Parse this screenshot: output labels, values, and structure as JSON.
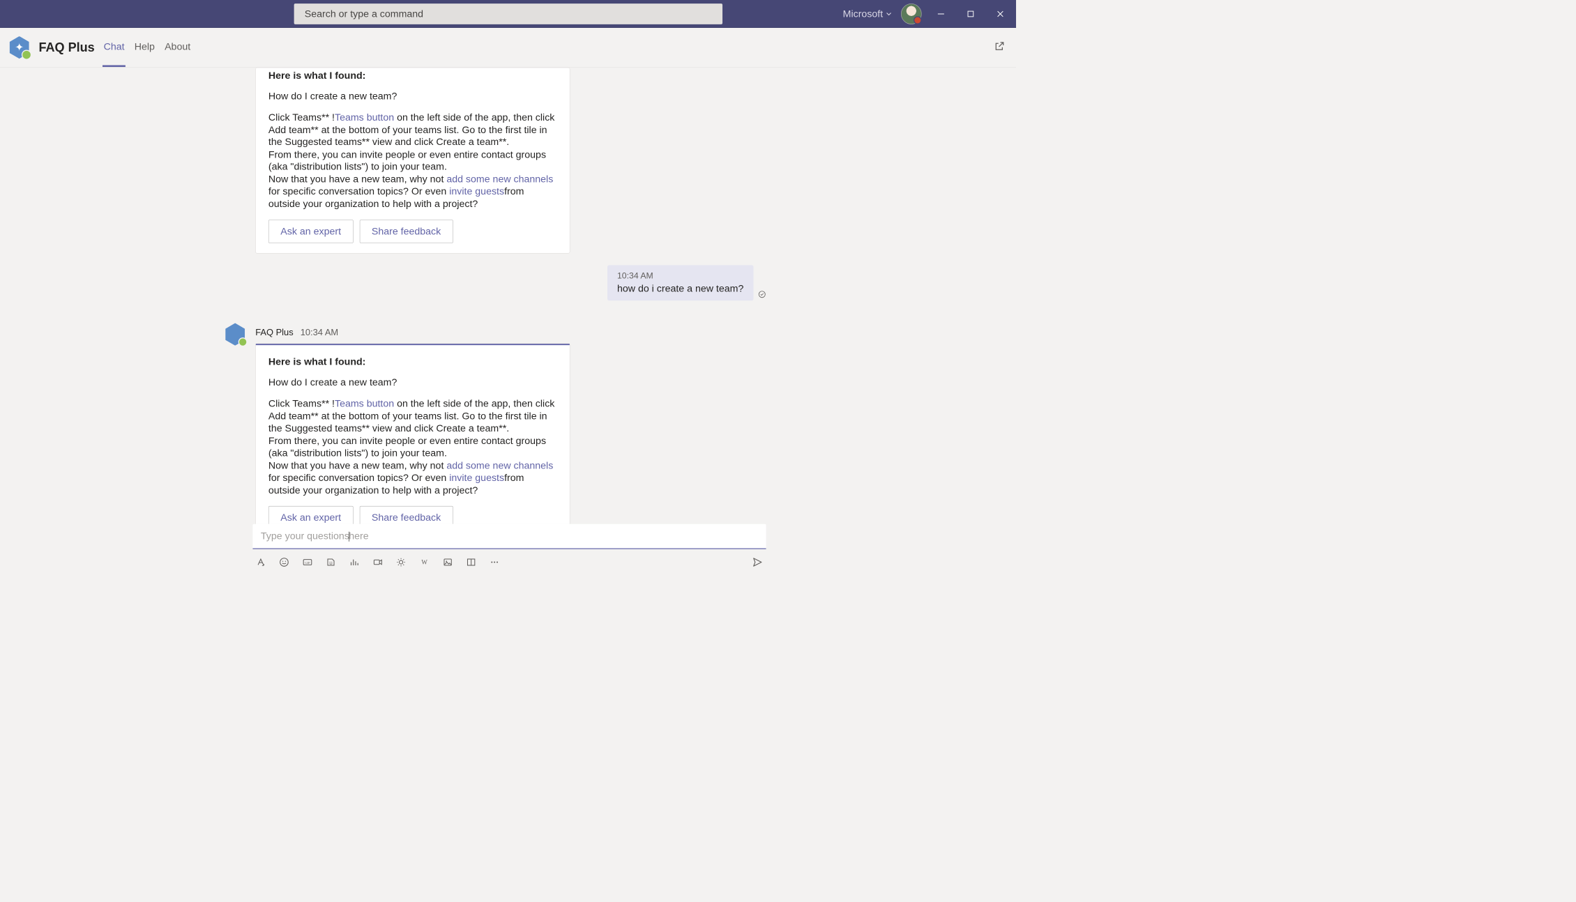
{
  "titlebar": {
    "search_placeholder": "Search or type a command",
    "org_label": "Microsoft"
  },
  "app": {
    "name": "FAQ Plus",
    "tabs": {
      "chat": "Chat",
      "help": "Help",
      "about": "About"
    }
  },
  "messages": {
    "bot1": {
      "heading": "Here is what I found:",
      "question": "How do I create a new team?",
      "body_part1": "Click Teams** !",
      "link1": "Teams button",
      "body_part2": " on the left side of the app, then click Add team** at the bottom of your teams list. Go to the first tile in the Suggested teams** view and click Create a team**.",
      "body_part3": "From there, you can invite people or even entire contact groups (aka \"distribution lists\") to join your team.",
      "body_part4a": "Now that you have a new team, why not ",
      "link2": "add some new channels",
      "body_part4b": " for specific conversation topics? Or even ",
      "link3": "invite guests",
      "body_part4c": "from outside your organization to help with a project?",
      "btn_expert": "Ask an expert",
      "btn_feedback": "Share feedback"
    },
    "user1": {
      "time": "10:34 AM",
      "text": "how do i create a new team?"
    },
    "bot2": {
      "sender": "FAQ Plus",
      "time": "10:34 AM",
      "heading": "Here is what I found:",
      "question": "How do I create a new team?",
      "body_part1": "Click Teams** !",
      "link1": "Teams button",
      "body_part2": " on the left side of the app, then click Add team** at the bottom of your teams list. Go to the first tile in the Suggested teams** view and click Create a team**.",
      "body_part3": "From there, you can invite people or even entire contact groups (aka \"distribution lists\") to join your team.",
      "body_part4a": "Now that you have a new team, why not ",
      "link2": "add some new channels",
      "body_part4b": " for specific conversation topics? Or even ",
      "link3": "invite guests",
      "body_part4c": "from outside your organization to help with a project?",
      "btn_expert": "Ask an expert",
      "btn_feedback": "Share feedback"
    }
  },
  "composer": {
    "placeholder_left": "Type your questions",
    "placeholder_right": "here"
  }
}
